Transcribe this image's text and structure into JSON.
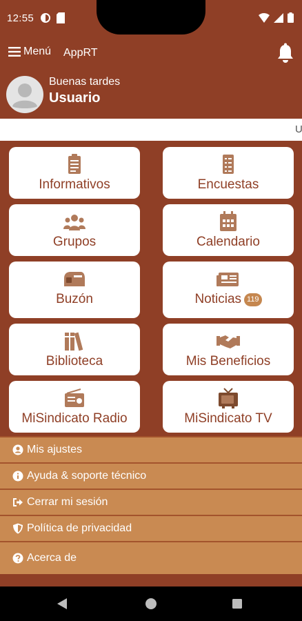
{
  "status": {
    "time": "12:55"
  },
  "appbar": {
    "menu_label": "Menú",
    "title": "AppRT"
  },
  "user": {
    "greeting": "Buenas tardes",
    "name": "Usuario"
  },
  "ticker": {
    "text": "U"
  },
  "tiles": [
    {
      "label": "Informativos",
      "icon": "clipboard-icon"
    },
    {
      "label": "Encuestas",
      "icon": "list-icon"
    },
    {
      "label": "Grupos",
      "icon": "users-icon"
    },
    {
      "label": "Calendario",
      "icon": "calendar-icon"
    },
    {
      "label": "Buzón",
      "icon": "mailbox-icon"
    },
    {
      "label": "Noticias",
      "icon": "newspaper-icon",
      "badge": "119"
    },
    {
      "label": "Biblioteca",
      "icon": "books-icon"
    },
    {
      "label": "Mis Beneficios",
      "icon": "handshake-icon"
    },
    {
      "label": "MiSindicato Radio",
      "icon": "radio-icon"
    },
    {
      "label": "MiSindicato TV",
      "icon": "tv-icon"
    }
  ],
  "menu": [
    {
      "label": "Mis ajustes",
      "icon": "user-circle-icon"
    },
    {
      "label": "Ayuda & soporte técnico",
      "icon": "info-icon"
    },
    {
      "label": "Cerrar mi sesión",
      "icon": "sign-out-icon"
    },
    {
      "label": "Política de privacidad",
      "icon": "shield-icon"
    },
    {
      "label": "Acerca de",
      "icon": "question-icon"
    }
  ],
  "colors": {
    "primary": "#8f3f26",
    "menu_bg": "#c98a52",
    "badge": "#c5874f",
    "tile_icon": "#b07a5a"
  }
}
